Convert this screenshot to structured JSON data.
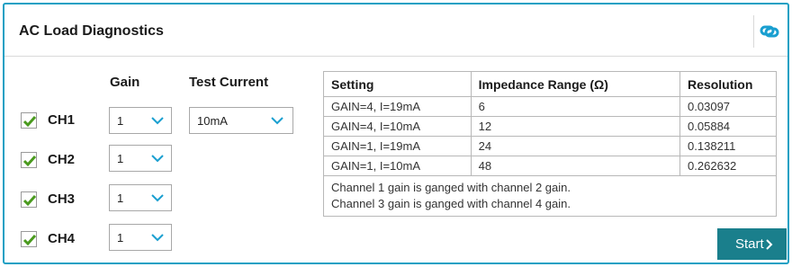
{
  "panel": {
    "title": "AC Load Diagnostics",
    "header_icon": "link-icon",
    "accent_color": "#1aa0c4"
  },
  "columns": {
    "gain_label": "Gain",
    "test_current_label": "Test Current"
  },
  "channels": [
    {
      "label": "CH1",
      "checked": true,
      "gain": "1"
    },
    {
      "label": "CH2",
      "checked": true,
      "gain": "1"
    },
    {
      "label": "CH3",
      "checked": true,
      "gain": "1"
    },
    {
      "label": "CH4",
      "checked": true,
      "gain": "1"
    }
  ],
  "test_current": {
    "value": "10mA"
  },
  "table": {
    "headers": [
      "Setting",
      "Impedance Range (Ω)",
      "Resolution"
    ],
    "rows": [
      [
        "GAIN=4, I=19mA",
        "6",
        "0.03097"
      ],
      [
        "GAIN=4, I=10mA",
        "12",
        "0.05884"
      ],
      [
        "GAIN=1, I=19mA",
        "24",
        "0.138211"
      ],
      [
        "GAIN=1, I=10mA",
        "48",
        "0.262632"
      ]
    ],
    "notes": [
      "Channel 1 gain is ganged with channel 2 gain.",
      "Channel 3 gain is ganged with channel 4 gain."
    ]
  },
  "start_button": {
    "label": "Start",
    "color": "#1a7f8c"
  },
  "colors": {
    "check": "#4a9a1e",
    "chevron": "#1a9fd0"
  }
}
